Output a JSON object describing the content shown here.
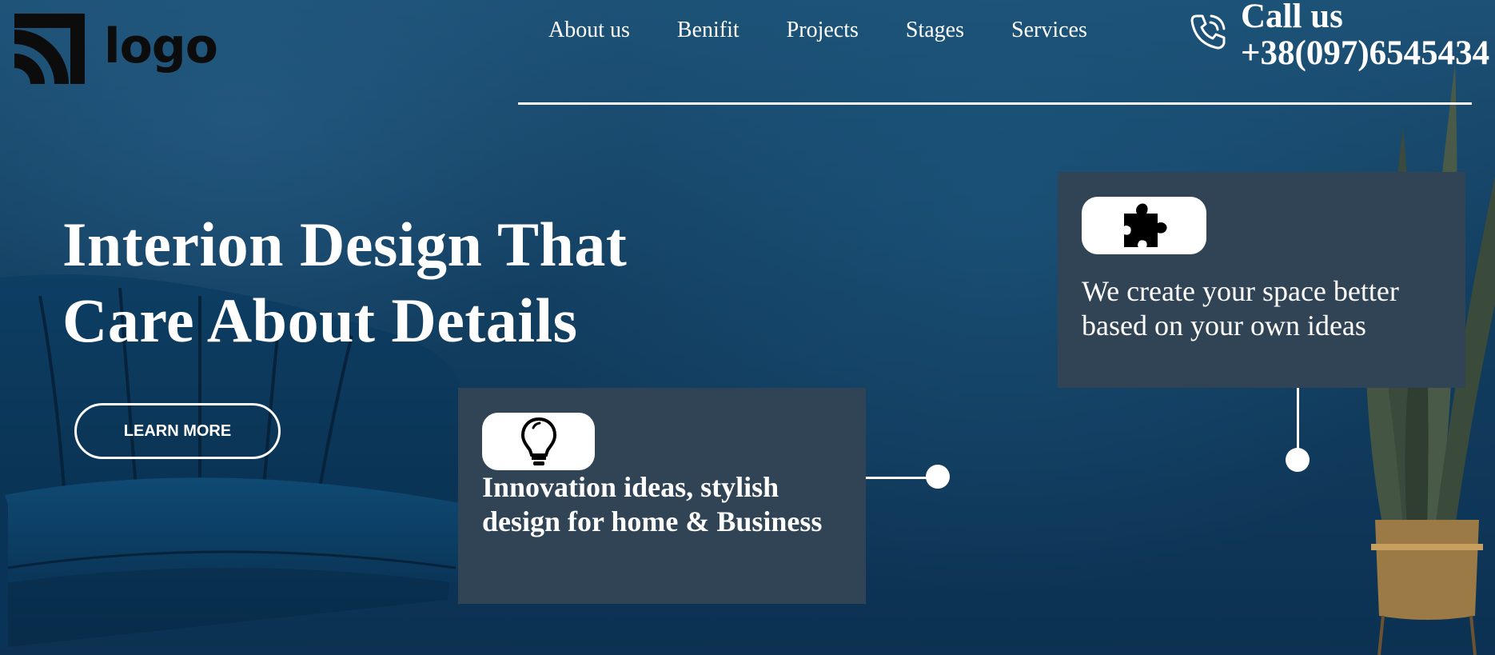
{
  "logo": {
    "text": "logo"
  },
  "nav": {
    "items": [
      "About us",
      "Benifit",
      "Projects",
      "Stages",
      "Services"
    ]
  },
  "contact": {
    "title": "Call us",
    "phone": "+38(097)6545434"
  },
  "hero": {
    "headline_line1": "Interion Design That",
    "headline_line2": "Care About Details",
    "button_label": "LEARN MORE"
  },
  "cards": [
    {
      "icon": "lightbulb-icon",
      "text": "Innovation ideas, stylish design for home & Business"
    },
    {
      "icon": "puzzle-icon",
      "text": "We create your space better based on your own ideas"
    }
  ],
  "colors": {
    "background": "#123e60",
    "card": "#314455",
    "text": "#ffffff"
  }
}
